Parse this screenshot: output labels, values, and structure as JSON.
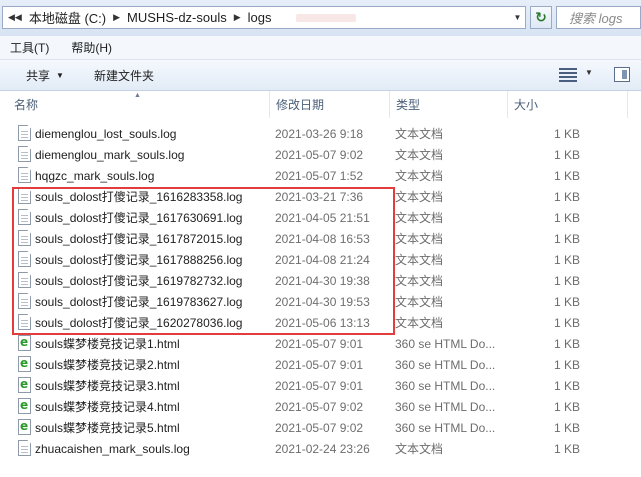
{
  "address": {
    "crumbs": [
      "本地磁盘 (C:)",
      "MUSHS-dz-souls",
      "logs"
    ],
    "search_placeholder": "搜索 logs"
  },
  "menu": {
    "tools": "工具(T)",
    "help": "帮助(H)"
  },
  "toolbar": {
    "share": "共享",
    "new_folder": "新建文件夹"
  },
  "columns": {
    "name": "名称",
    "date": "修改日期",
    "type": "类型",
    "size": "大小"
  },
  "files": [
    {
      "name": "diemenglou_lost_souls.log",
      "date": "2021-03-26 9:18",
      "type": "文本文档",
      "size": "1 KB",
      "kind": "doc"
    },
    {
      "name": "diemenglou_mark_souls.log",
      "date": "2021-05-07 9:02",
      "type": "文本文档",
      "size": "1 KB",
      "kind": "doc"
    },
    {
      "name": "hqgzc_mark_souls.log",
      "date": "2021-05-07 1:52",
      "type": "文本文档",
      "size": "1 KB",
      "kind": "doc"
    },
    {
      "name": "souls_dolost打傻记录_1616283358.log",
      "date": "2021-03-21 7:36",
      "type": "文本文档",
      "size": "1 KB",
      "kind": "doc"
    },
    {
      "name": "souls_dolost打傻记录_1617630691.log",
      "date": "2021-04-05 21:51",
      "type": "文本文档",
      "size": "1 KB",
      "kind": "doc"
    },
    {
      "name": "souls_dolost打傻记录_1617872015.log",
      "date": "2021-04-08 16:53",
      "type": "文本文档",
      "size": "1 KB",
      "kind": "doc"
    },
    {
      "name": "souls_dolost打傻记录_1617888256.log",
      "date": "2021-04-08 21:24",
      "type": "文本文档",
      "size": "1 KB",
      "kind": "doc"
    },
    {
      "name": "souls_dolost打傻记录_1619782732.log",
      "date": "2021-04-30 19:38",
      "type": "文本文档",
      "size": "1 KB",
      "kind": "doc"
    },
    {
      "name": "souls_dolost打傻记录_1619783627.log",
      "date": "2021-04-30 19:53",
      "type": "文本文档",
      "size": "1 KB",
      "kind": "doc"
    },
    {
      "name": "souls_dolost打傻记录_1620278036.log",
      "date": "2021-05-06 13:13",
      "type": "文本文档",
      "size": "1 KB",
      "kind": "doc"
    },
    {
      "name": "souls蝶梦楼竞技记录1.html",
      "date": "2021-05-07 9:01",
      "type": "360 se HTML Do...",
      "size": "1 KB",
      "kind": "html"
    },
    {
      "name": "souls蝶梦楼竞技记录2.html",
      "date": "2021-05-07 9:01",
      "type": "360 se HTML Do...",
      "size": "1 KB",
      "kind": "html"
    },
    {
      "name": "souls蝶梦楼竞技记录3.html",
      "date": "2021-05-07 9:01",
      "type": "360 se HTML Do...",
      "size": "1 KB",
      "kind": "html"
    },
    {
      "name": "souls蝶梦楼竞技记录4.html",
      "date": "2021-05-07 9:02",
      "type": "360 se HTML Do...",
      "size": "1 KB",
      "kind": "html"
    },
    {
      "name": "souls蝶梦楼竞技记录5.html",
      "date": "2021-05-07 9:02",
      "type": "360 se HTML Do...",
      "size": "1 KB",
      "kind": "html"
    },
    {
      "name": "zhuacaishen_mark_souls.log",
      "date": "2021-02-24 23:26",
      "type": "文本文档",
      "size": "1 KB",
      "kind": "doc"
    }
  ],
  "highlight_color": "#e23c3c"
}
